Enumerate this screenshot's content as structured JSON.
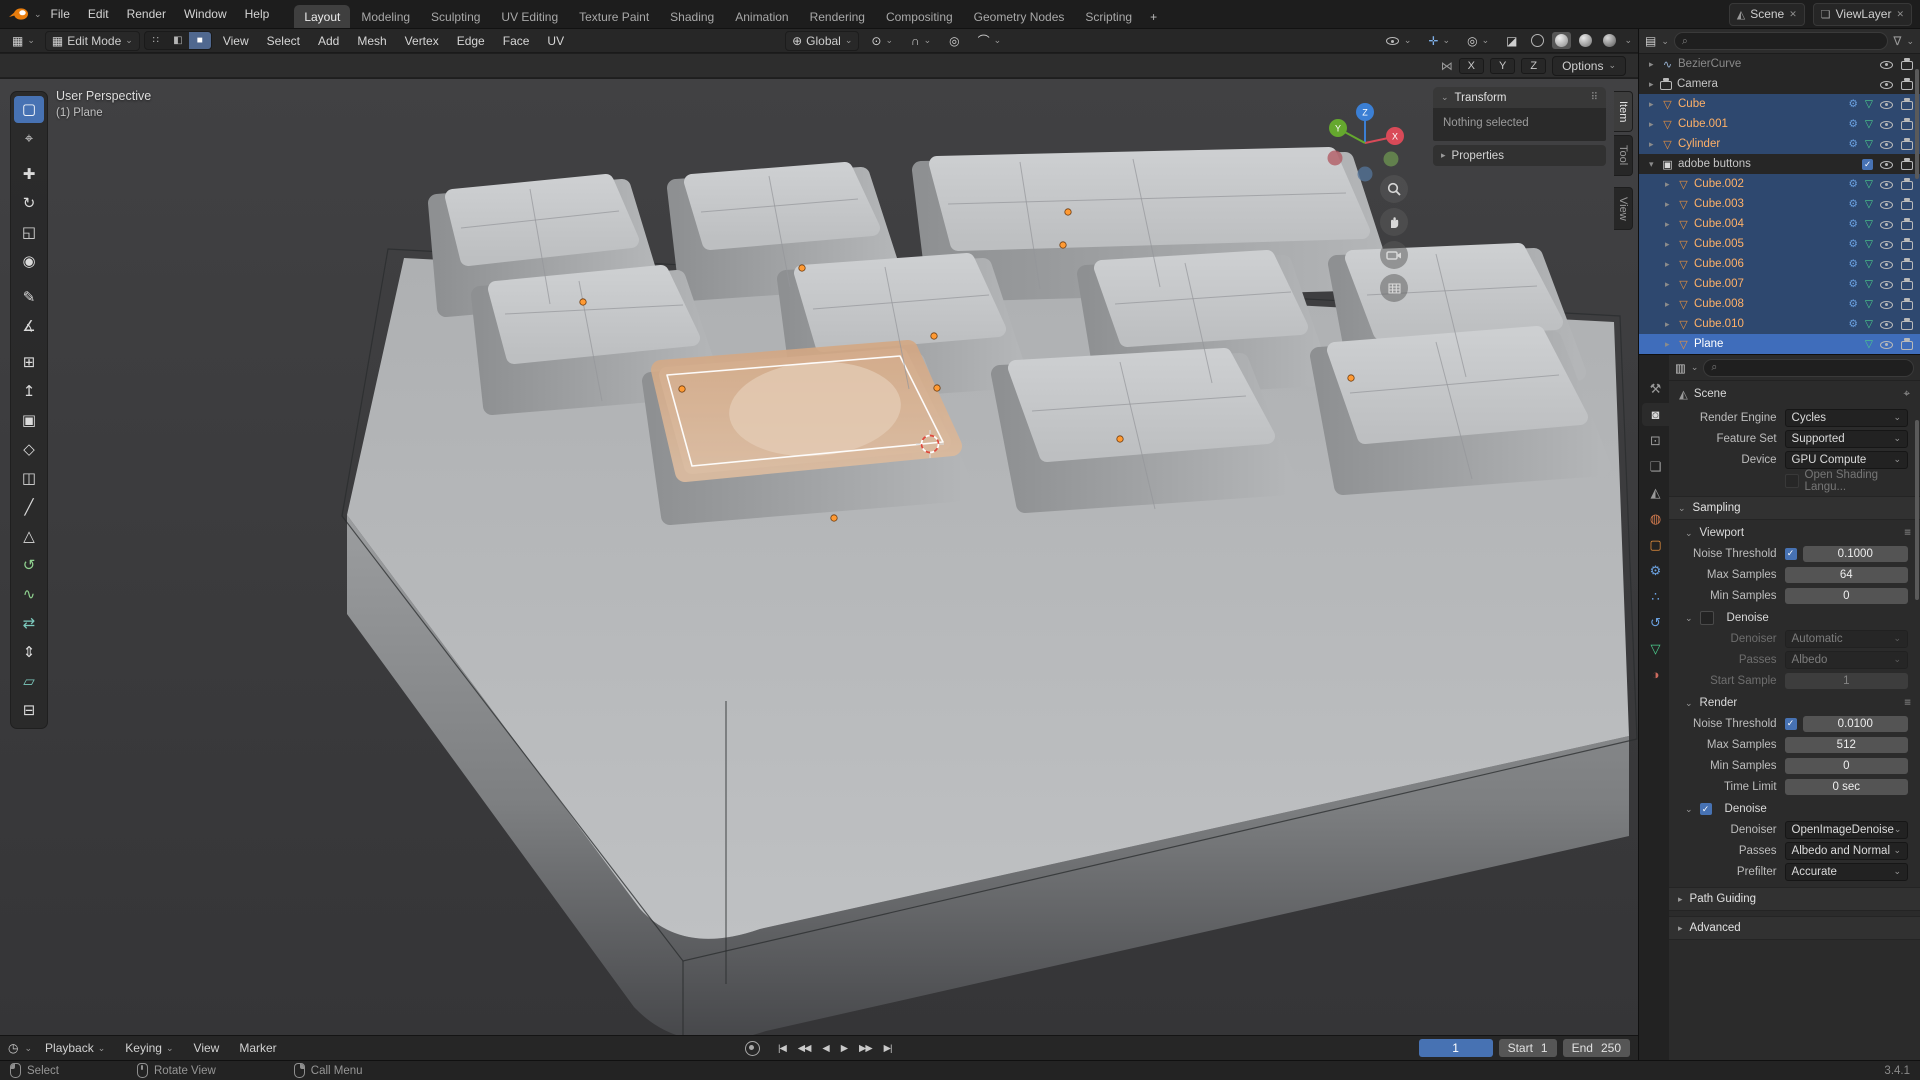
{
  "colors": {
    "accent": "#4772b3",
    "object_orange": "#e8913d",
    "selected_text": "#ffb168",
    "selection_face": "#d2a182"
  },
  "ui": {
    "chev": "⌄",
    "tri_r": "▸",
    "tri_d": "▾",
    "search": "⌕",
    "funnel": "∇",
    "grip": "⠿",
    "lines": "≡",
    "check": "✓",
    "pin": "⌖",
    "x": "✕",
    "globe": "⊕",
    "pivot": "⊙",
    "magnet": "∩",
    "prop": "◎",
    "falloff": "⌒",
    "xray": "◪",
    "gizmo": "✛",
    "overlay": "◎",
    "mirror": "⋈",
    "editor_view3d": "▦",
    "editor_outliner": "▤",
    "editor_props": "▥",
    "editor_timeline": "◷",
    "editmode_icon": "▦",
    "mesh": "▽",
    "curve": "∿",
    "collection": "▣",
    "modifier": "⚙",
    "data": "▽",
    "mode_vertex": "∷",
    "mode_edge": "◧",
    "mode_face": "■"
  },
  "topbar": {
    "menus": [
      "File",
      "Edit",
      "Render",
      "Window",
      "Help"
    ],
    "workspaces": [
      "Layout",
      "Modeling",
      "Sculpting",
      "UV Editing",
      "Texture Paint",
      "Shading",
      "Animation",
      "Rendering",
      "Compositing",
      "Geometry Nodes",
      "Scripting"
    ],
    "add_workspace": "+",
    "scene_label": "Scene",
    "scene_icon": "◭",
    "view_layer_label": "ViewLayer",
    "view_layer_icon": "❏"
  },
  "viewport_header": {
    "mode": "Edit Mode",
    "menus": [
      "View",
      "Select",
      "Add",
      "Mesh",
      "Vertex",
      "Edge",
      "Face",
      "UV"
    ],
    "orientation": "Global",
    "mirror_x": "X",
    "mirror_y": "Y",
    "mirror_z": "Z",
    "options": "Options"
  },
  "viewport": {
    "perspective": "User Perspective",
    "active_object": "(1) Plane",
    "npanel": {
      "transform": "Transform",
      "empty": "Nothing selected",
      "properties": "Properties",
      "tab_item": "Item",
      "tab_tool": "Tool",
      "tab_view": "View"
    },
    "axis_x": "X",
    "axis_y": "Y",
    "axis_z": "Z"
  },
  "toolbar": {
    "tools": [
      {
        "name": "select-box",
        "glyph": "▢"
      },
      {
        "name": "cursor",
        "glyph": "⌖"
      },
      {
        "name": "move",
        "glyph": "✚"
      },
      {
        "name": "rotate",
        "glyph": "↻"
      },
      {
        "name": "scale",
        "glyph": "◱"
      },
      {
        "name": "transform",
        "glyph": "◉"
      },
      {
        "name": "annotate",
        "glyph": "✎"
      },
      {
        "name": "measure",
        "glyph": "∡"
      },
      {
        "name": "add-cube",
        "glyph": "⊞"
      },
      {
        "name": "extrude-region",
        "glyph": "↥"
      },
      {
        "name": "inset-faces",
        "glyph": "▣"
      },
      {
        "name": "bevel",
        "glyph": "◇"
      },
      {
        "name": "loop-cut",
        "glyph": "◫"
      },
      {
        "name": "knife",
        "glyph": "╱"
      },
      {
        "name": "poly-build",
        "glyph": "△"
      },
      {
        "name": "spin",
        "glyph": "↺"
      },
      {
        "name": "smooth",
        "glyph": "∿"
      },
      {
        "name": "edge-slide",
        "glyph": "⇄"
      },
      {
        "name": "shrink-fatten",
        "glyph": "⇕"
      },
      {
        "name": "shear",
        "glyph": "▱"
      },
      {
        "name": "rip-region",
        "glyph": "⊟"
      }
    ]
  },
  "outliner": {
    "rows": [
      {
        "name": "BezierCurve"
      },
      {
        "name": "Camera"
      },
      {
        "name": "Cube"
      },
      {
        "name": "Cube.001"
      },
      {
        "name": "Cylinder"
      },
      {
        "name": "adobe buttons"
      },
      {
        "name": "Cube.002"
      },
      {
        "name": "Cube.003"
      },
      {
        "name": "Cube.004"
      },
      {
        "name": "Cube.005"
      },
      {
        "name": "Cube.006"
      },
      {
        "name": "Cube.007"
      },
      {
        "name": "Cube.008"
      },
      {
        "name": "Cube.010"
      },
      {
        "name": "Pl ane"
      }
    ]
  },
  "properties": {
    "tabs": [
      {
        "name": "tool",
        "glyph": "⚒"
      },
      {
        "name": "render",
        "glyph": "◙"
      },
      {
        "name": "output",
        "glyph": "⊡"
      },
      {
        "name": "view-layer",
        "glyph": "❏"
      },
      {
        "name": "scene",
        "glyph": "◭"
      },
      {
        "name": "world",
        "glyph": "◍"
      },
      {
        "name": "object",
        "glyph": "▢"
      },
      {
        "name": "modifiers",
        "glyph": "⚙"
      },
      {
        "name": "particles",
        "glyph": "∴"
      },
      {
        "name": "physics",
        "glyph": "↺"
      },
      {
        "name": "object-data",
        "glyph": "▽"
      },
      {
        "name": "material",
        "glyph": "◑"
      }
    ],
    "breadcrumb": "Scene",
    "re_l": "Render Engine",
    "re_v": "Cycles",
    "fs_l": "Feature Set",
    "fs_v": "Supported",
    "dev_l": "Device",
    "dev_v": "GPU Compute",
    "osl": "Open Shading Langu...",
    "sampling": "Sampling",
    "vp_title": "Viewport",
    "vp_nt_l": "Noise Threshold",
    "vp_nt": "0.1000",
    "vp_max_l": "Max Samples",
    "vp_max": "64",
    "vp_min_l": "Min Samples",
    "vp_min": "0",
    "dn1": "Denoise",
    "dn1_dl": "Denoiser",
    "dn1_dv": "Automatic",
    "dn1_pl": "Passes",
    "dn1_pv": "Albedo",
    "dn1_sl": "Start Sample",
    "dn1_sv": "1",
    "rn_title": "Render",
    "rn_nt_l": "Noise Threshold",
    "rn_nt": "0.0100",
    "rn_max_l": "Max Samples",
    "rn_max": "512",
    "rn_min_l": "Min Samples",
    "rn_min": "0",
    "rn_tl": "Time Limit",
    "rn_tv": "0 sec",
    "dn2": "Denoise",
    "dn2_dl": "Denoiser",
    "dn2_dv": "OpenImageDenoise",
    "dn2_pl": "Passes",
    "dn2_pv": "Albedo and Normal",
    "dn2_fl": "Prefilter",
    "dn2_fv": "Accurate",
    "pg": "Path Guiding",
    "adv": "Advanced"
  },
  "timeline": {
    "menu_playback": "Playback",
    "menu_keying": "Keying",
    "menu_view": "View",
    "menu_marker": "Marker",
    "transport": [
      "|◀",
      "◀◀",
      "◀",
      "▶",
      "▶▶",
      "▶|"
    ],
    "frame": "1",
    "start_label": "Start",
    "start": "1",
    "end_label": "End",
    "end": "250"
  },
  "statusbar": {
    "select": "Select",
    "rotate": "Rotate View",
    "call": "Call Menu",
    "version": "3.4.1"
  }
}
